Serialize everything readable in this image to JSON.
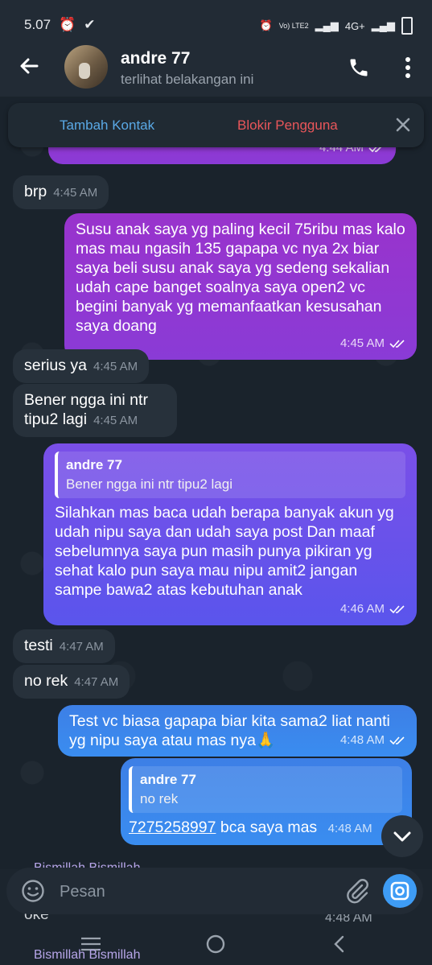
{
  "status_bar": {
    "time": "5.07",
    "network": "4G+",
    "volte": "Vo) LTE2"
  },
  "header": {
    "contact_name": "andre 77",
    "contact_status": "terlihat belakangan ini"
  },
  "action_bar": {
    "add_contact": "Tambah Kontak",
    "block_user": "Blokir Pengguna"
  },
  "messages": [
    {
      "dir": "out",
      "text": "",
      "time": "4:44 AM"
    },
    {
      "dir": "in",
      "text": "brp",
      "time": "4:45 AM"
    },
    {
      "dir": "out",
      "text": "Susu anak saya yg paling kecil 75ribu mas kalo mas mau ngasih 135 gapapa vc nya 2x biar saya beli susu anak saya yg sedeng sekalian udah cape banget soalnya saya open2 vc begini banyak yg memanfaatkan kesusahan saya doang",
      "time": "4:45 AM"
    },
    {
      "dir": "in",
      "text": "serius ya",
      "time": "4:45 AM"
    },
    {
      "dir": "in",
      "text": "Bener ngga ini ntr tipu2 lagi",
      "time": "4:45 AM"
    },
    {
      "dir": "out",
      "reply_name": "andre 77",
      "reply_text": "Bener ngga ini ntr tipu2 lagi",
      "text": "Silahkan mas baca udah berapa banyak akun yg udah nipu saya dan udah saya post Dan maaf sebelumnya saya pun masih punya pikiran yg sehat kalo pun saya mau nipu amit2 jangan sampe bawa2 atas kebutuhan anak",
      "time": "4:46 AM"
    },
    {
      "dir": "in",
      "text": "testi",
      "time": "4:47 AM"
    },
    {
      "dir": "in",
      "text": "no rek",
      "time": "4:47 AM"
    },
    {
      "dir": "out",
      "text": "Test vc biasa gapapa biar kita sama2 liat nanti yg nipu saya atau mas nya🙏",
      "time": "4:48 AM"
    },
    {
      "dir": "out",
      "reply_name": "andre 77",
      "reply_text": "no rek",
      "account_number": "7275258997",
      "text": " bca saya mas",
      "time": "4:48 AM"
    }
  ],
  "partial": {
    "reply_top": "Bismillah Bismillah",
    "text_oke": "oke",
    "time_oke": "4:48 AM",
    "reply_bottom": "Bismillah Bismillah"
  },
  "composer": {
    "placeholder": "Pesan"
  }
}
